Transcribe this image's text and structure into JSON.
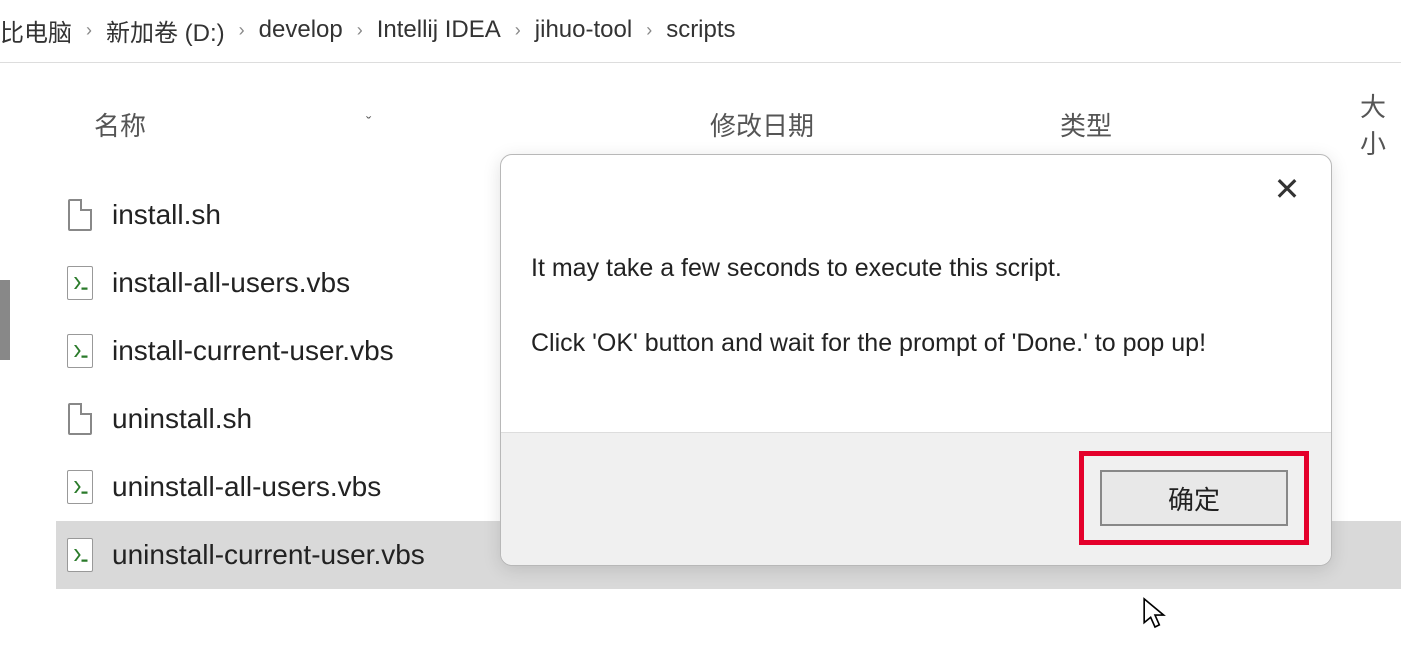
{
  "breadcrumb": {
    "items": [
      "比电脑",
      "新加卷 (D:)",
      "develop",
      "Intellij IDEA",
      "jihuo-tool",
      "scripts"
    ]
  },
  "columns": {
    "name": "名称",
    "date": "修改日期",
    "type": "类型",
    "size": "大小"
  },
  "files": [
    {
      "name": "install.sh",
      "icon": "plain"
    },
    {
      "name": "install-all-users.vbs",
      "icon": "vbs"
    },
    {
      "name": "install-current-user.vbs",
      "icon": "vbs"
    },
    {
      "name": "uninstall.sh",
      "icon": "plain"
    },
    {
      "name": "uninstall-all-users.vbs",
      "icon": "vbs"
    },
    {
      "name": "uninstall-current-user.vbs",
      "icon": "vbs",
      "selected": true
    }
  ],
  "dialog": {
    "line1": "It may take a few seconds to execute this script.",
    "line2": "Click 'OK' button and wait for the prompt of 'Done.' to pop up!",
    "ok": "确定"
  }
}
